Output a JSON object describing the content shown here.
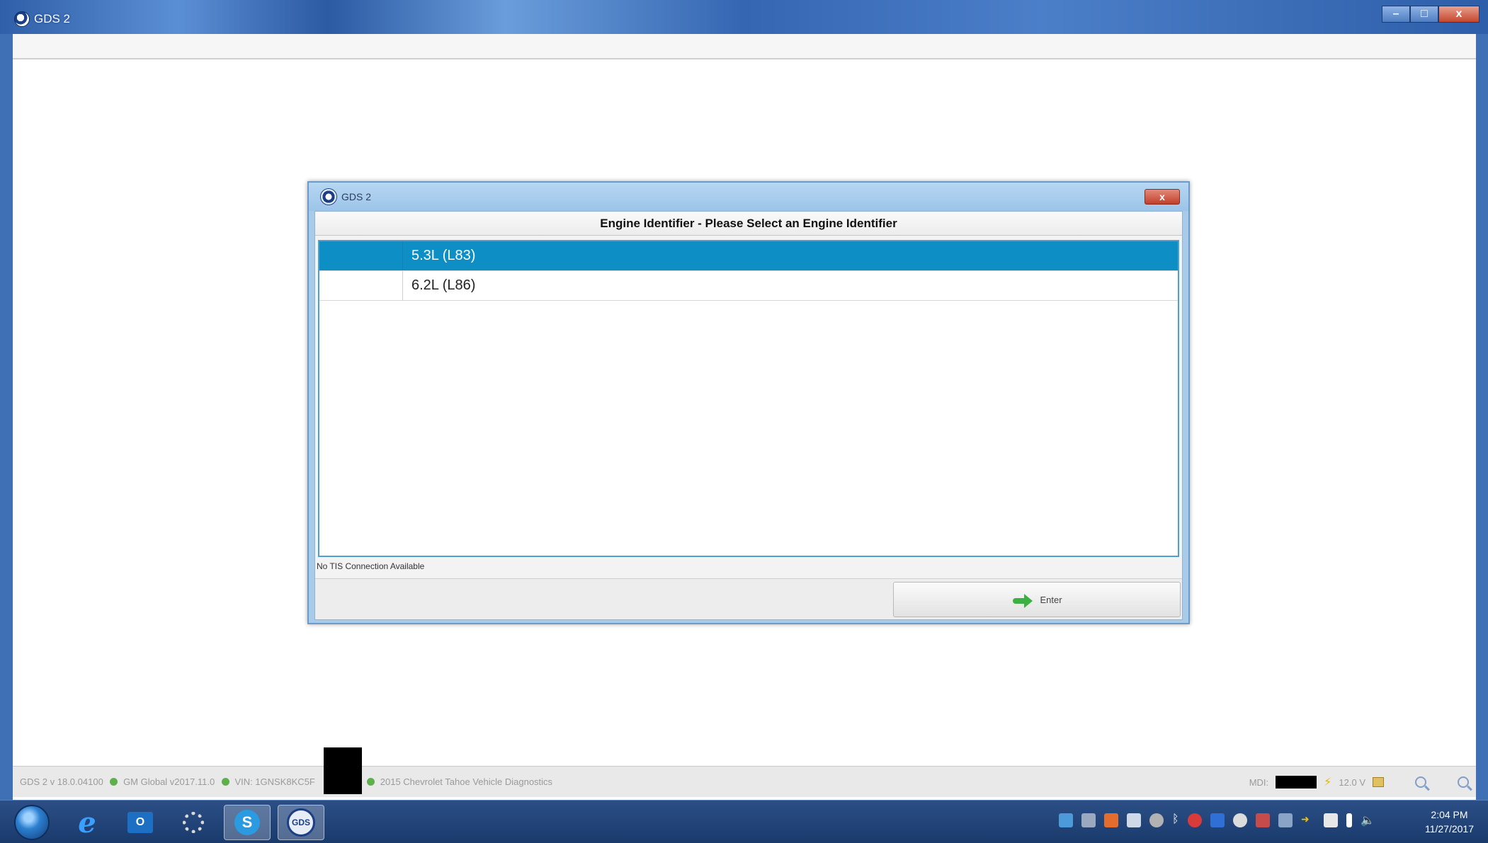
{
  "window": {
    "title": "GDS 2",
    "minimize_label": "–",
    "maximize_label": "□",
    "close_label": "x"
  },
  "dialog": {
    "title": "GDS 2",
    "close_label": "x",
    "header": "Engine Identifier - Please Select an Engine Identifier",
    "options": [
      {
        "label": "5.3L (L83)",
        "selected": true
      },
      {
        "label": "6.2L (L86)",
        "selected": false
      }
    ],
    "tis_note": "No TIS Connection Available",
    "enter_label": "Enter"
  },
  "statusbar": {
    "version": "GDS 2 v 18.0.04100",
    "global": "GM Global v2017.11.0",
    "vin": "VIN: 1GNSK8KC5F",
    "vehicle": "2015 Chevrolet Tahoe Vehicle Diagnostics",
    "mdi_label": "MDI:",
    "voltage": "12.0 V"
  },
  "taskbar": {
    "gds_label": "GDS",
    "outlook_label": "O",
    "skype_label": "S",
    "ie_label": "e",
    "time": "2:04 PM",
    "date": "11/27/2017"
  },
  "colors": {
    "selected_row": "#0d8fc6",
    "dialog_frame": "#a9cbea",
    "status_dot": "#5fb04d"
  }
}
